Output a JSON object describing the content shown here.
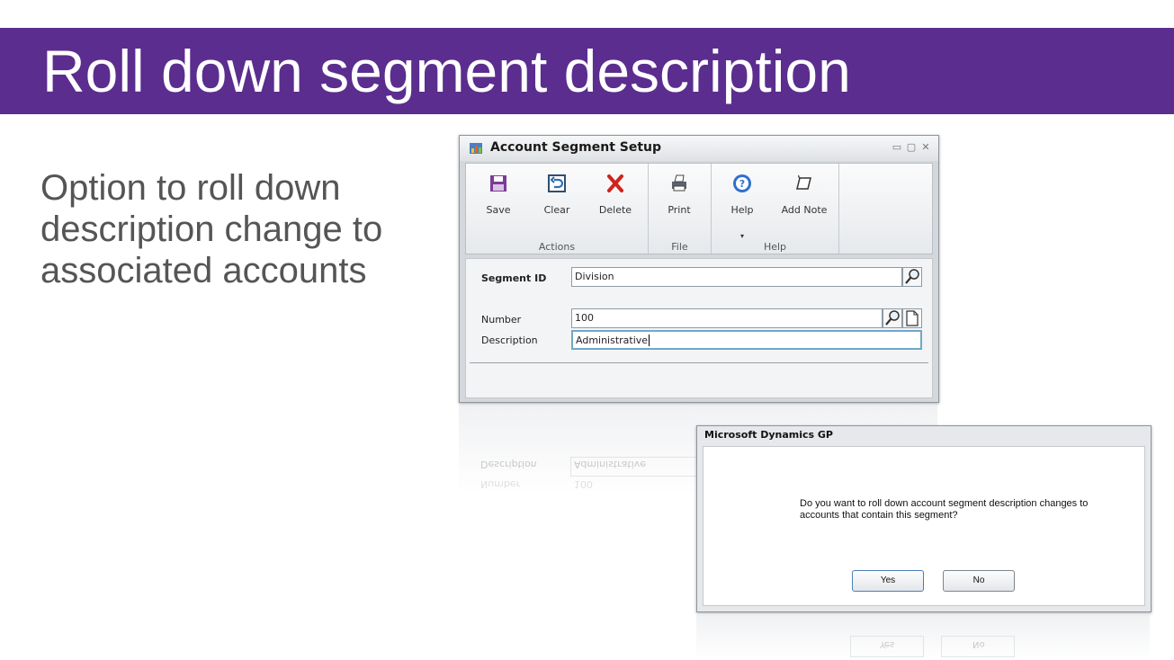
{
  "slide": {
    "title": "Roll down segment description",
    "body_text": "Option to roll down description change to associated accounts",
    "banner_color": "#5b2d8e"
  },
  "window": {
    "title": "Account Segment Setup",
    "controls": {
      "minimize": "▭",
      "maximize": "▢",
      "close": "✕"
    },
    "ribbon": {
      "groups": [
        {
          "label": "Actions",
          "buttons": [
            {
              "label": "Save",
              "icon": "save-icon"
            },
            {
              "label": "Clear",
              "icon": "clear-icon"
            },
            {
              "label": "Delete",
              "icon": "delete-icon"
            }
          ]
        },
        {
          "label": "File",
          "buttons": [
            {
              "label": "Print",
              "icon": "print-icon"
            }
          ]
        },
        {
          "label": "Help",
          "buttons": [
            {
              "label": "Help",
              "icon": "help-icon",
              "dropdown": "▾"
            },
            {
              "label": "Add Note",
              "icon": "note-icon"
            }
          ]
        }
      ]
    },
    "form": {
      "segment_id_label": "Segment ID",
      "segment_id_value": "Division",
      "number_label": "Number",
      "number_value": "100",
      "description_label": "Description",
      "description_value": "Administrative"
    }
  },
  "dialog": {
    "title": "Microsoft Dynamics GP",
    "message": "Do you want to roll down account segment description changes to accounts that contain this segment?",
    "yes_label": "Yes",
    "no_label": "No"
  }
}
